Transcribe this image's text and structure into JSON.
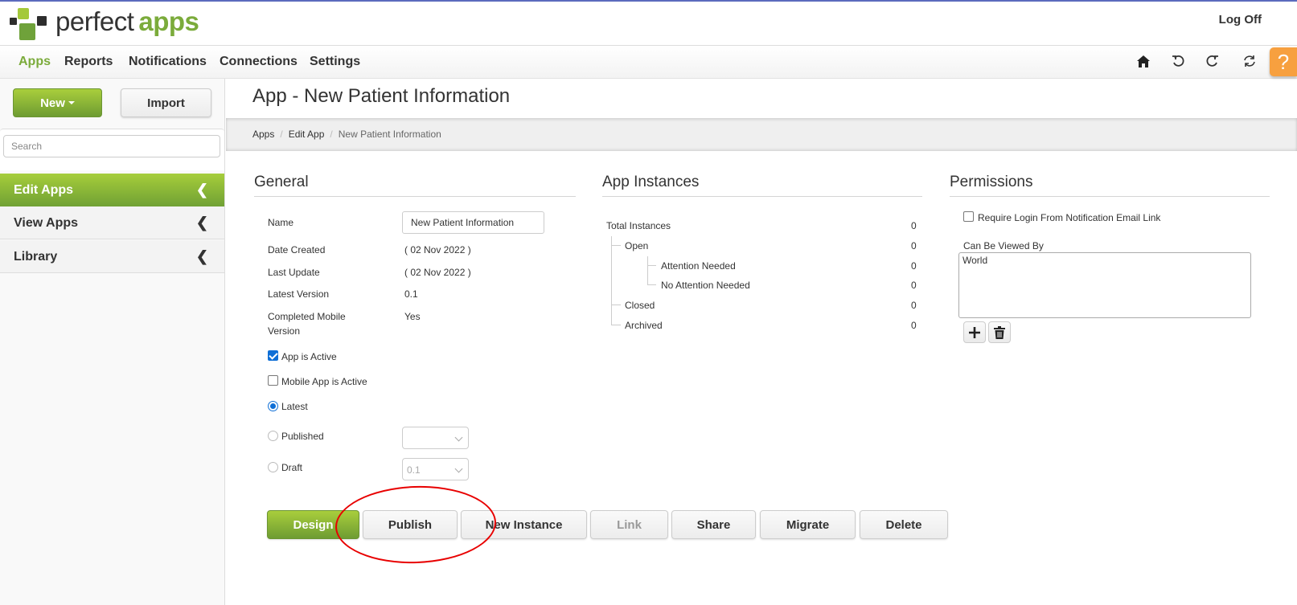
{
  "header": {
    "brand_part1": "perfect",
    "brand_part2": "apps",
    "logoff_label": "Log Off",
    "brand_color": "#7bab3b"
  },
  "nav": {
    "items": [
      {
        "label": "Apps",
        "active": true
      },
      {
        "label": "Reports"
      },
      {
        "label": "Notifications"
      },
      {
        "label": "Connections"
      },
      {
        "label": "Settings"
      }
    ],
    "icons": [
      "home-icon",
      "undo-icon",
      "redo-icon",
      "sync-icon"
    ],
    "help_label": "?",
    "help_color": "#f7a03f"
  },
  "sidebar": {
    "new_label": "New",
    "import_label": "Import",
    "search_placeholder": "Search",
    "items": [
      {
        "label": "Edit Apps",
        "active": true
      },
      {
        "label": "View Apps"
      },
      {
        "label": "Library"
      }
    ]
  },
  "page": {
    "title": "App - New Patient Information",
    "breadcrumb": [
      "Apps",
      "Edit App",
      "New Patient Information"
    ]
  },
  "general": {
    "heading": "General",
    "name_label": "Name",
    "name_value": "New Patient Information",
    "date_created_label": "Date Created",
    "date_created_value": "( 02 Nov 2022 )",
    "last_update_label": "Last Update",
    "last_update_value": "( 02 Nov 2022 )",
    "latest_version_label": "Latest Version",
    "latest_version_value": "0.1",
    "completed_mobile_label_1": "Completed Mobile",
    "completed_mobile_label_2": "Version",
    "completed_mobile_value": "Yes",
    "app_active_label": "App is Active",
    "app_active_checked": true,
    "mobile_active_label": "Mobile App is Active",
    "mobile_active_checked": false,
    "version_options": [
      {
        "label": "Latest",
        "selected": true
      },
      {
        "label": "Published",
        "selected": false,
        "select_value": ""
      },
      {
        "label": "Draft",
        "selected": false,
        "select_value": "0.1"
      }
    ]
  },
  "instances": {
    "heading": "App Instances",
    "rows": [
      {
        "label": "Total Instances",
        "count": "0"
      },
      {
        "label": "Open",
        "count": "0"
      },
      {
        "label": "Attention Needed",
        "count": "0"
      },
      {
        "label": "No Attention Needed",
        "count": "0"
      },
      {
        "label": "Closed",
        "count": "0"
      },
      {
        "label": "Archived",
        "count": "0"
      }
    ]
  },
  "permissions": {
    "heading": "Permissions",
    "require_login_label": "Require Login From Notification Email Link",
    "require_login_checked": false,
    "viewed_by_label": "Can Be Viewed By",
    "viewed_by_items": [
      "World"
    ]
  },
  "actions": {
    "design": "Design",
    "publish": "Publish",
    "new_instance": "New Instance",
    "link": "Link",
    "share": "Share",
    "migrate": "Migrate",
    "delete": "Delete"
  }
}
